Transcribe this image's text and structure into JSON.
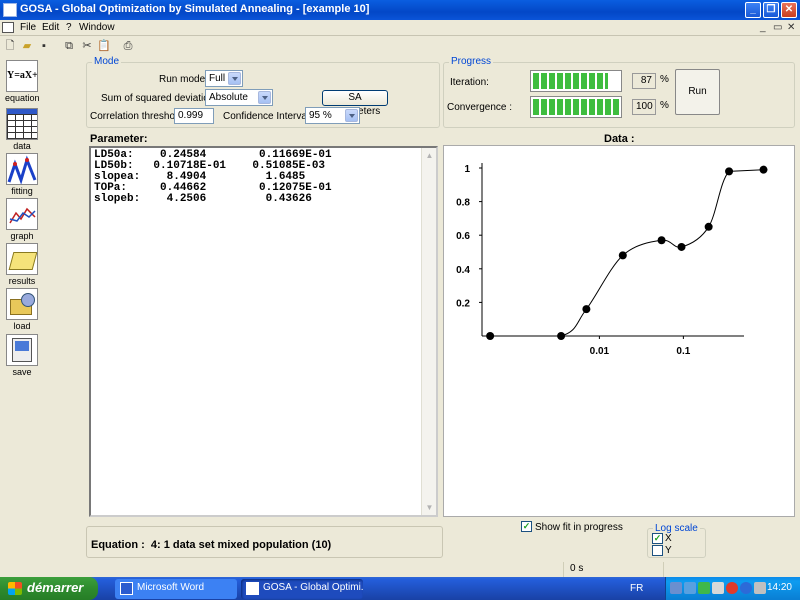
{
  "window": {
    "title": "GOSA - Global Optimization by Simulated Annealing - [example 10]"
  },
  "menu": {
    "items": [
      "File",
      "Edit",
      "?",
      "Window"
    ]
  },
  "sidebar": {
    "items": [
      {
        "label": "equation",
        "icon": "equation-icon"
      },
      {
        "label": "data",
        "icon": "table-icon"
      },
      {
        "label": "fitting",
        "icon": "fitting-icon"
      },
      {
        "label": "graph",
        "icon": "graph-icon"
      },
      {
        "label": "results",
        "icon": "results-icon"
      },
      {
        "label": "load",
        "icon": "load-icon"
      },
      {
        "label": "save",
        "icon": "save-icon"
      }
    ]
  },
  "mode": {
    "group_label": "Mode",
    "run_mode_label": "Run mode :",
    "run_mode_value": "Full",
    "ssd_label": "Sum of squared deviations :",
    "ssd_value": "Absolute",
    "sa_button": "SA parameters",
    "corr_label": "Correlation threshold :",
    "corr_value": "0.999",
    "ci_label": "Confidence Interval :",
    "ci_value": "95 %"
  },
  "progress": {
    "group_label": "Progress",
    "iteration_label": "Iteration:",
    "iteration_fraction": 0.87,
    "iteration_value": "87",
    "convergence_label": "Convergence :",
    "convergence_fraction": 1.0,
    "convergence_value": "100",
    "percent_sign": "%",
    "run_button": "Run"
  },
  "parameters": {
    "title": "Parameter:",
    "rows": [
      "LD50a:    0.24584        0.11669E-01",
      "LD50b:   0.10718E-01    0.51085E-03",
      "slopea:    8.4904         1.6485",
      "TOPa:     0.44662        0.12075E-01",
      "slopeb:    4.2506         0.43626"
    ]
  },
  "chart_data": {
    "type": "scatter",
    "title": "Data :",
    "xscale": "log",
    "x_tick_labels": [
      "0.01",
      "0.1"
    ],
    "y_tick_labels": [
      "0.2",
      "0.4",
      "0.6",
      "0.8",
      "1"
    ],
    "ylim": [
      0,
      1
    ],
    "points": [
      {
        "x": 0.0005,
        "y": 0.0
      },
      {
        "x": 0.0035,
        "y": 0.0
      },
      {
        "x": 0.007,
        "y": 0.16
      },
      {
        "x": 0.019,
        "y": 0.48
      },
      {
        "x": 0.055,
        "y": 0.57
      },
      {
        "x": 0.095,
        "y": 0.53
      },
      {
        "x": 0.2,
        "y": 0.65
      },
      {
        "x": 0.35,
        "y": 0.98
      },
      {
        "x": 0.9,
        "y": 0.99
      }
    ],
    "fit_curve": true
  },
  "equation": {
    "label": "Equation :",
    "value": "4: 1 data set mixed population (10)"
  },
  "options": {
    "show_fit_label": "Show fit in progress",
    "show_fit_checked": true,
    "log_scale_label": "Log scale",
    "log_x_label": "X",
    "log_x_checked": true,
    "log_y_label": "Y",
    "log_y_checked": false
  },
  "status": {
    "time": "0 s"
  },
  "taskbar": {
    "start_label": "démarrer",
    "tasks": [
      {
        "label": "Microsoft Word"
      },
      {
        "label": "GOSA - Global Optimi..."
      }
    ],
    "language": "FR",
    "clock": "14:20"
  }
}
